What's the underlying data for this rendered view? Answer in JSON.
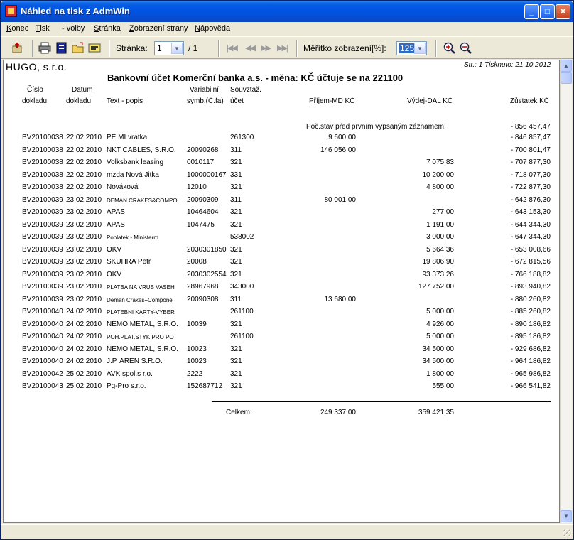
{
  "window": {
    "title": "Náhled na tisk z AdmWin"
  },
  "menu": [
    {
      "label": "Konec",
      "u": "K",
      "rest": "onec"
    },
    {
      "label": "Tisk",
      "u": "T",
      "rest": "isk"
    },
    {
      "label": "- volby",
      "u": "",
      "rest": "- volby"
    },
    {
      "label": "Stránka",
      "u": "S",
      "rest": "tránka"
    },
    {
      "label": "Zobrazení strany",
      "u": "Z",
      "rest": "obrazení strany"
    },
    {
      "label": "Nápověda",
      "u": "N",
      "rest": "ápověda"
    }
  ],
  "toolbar": {
    "page_label": "Stránka:",
    "page_value": "1",
    "page_total": "/ 1",
    "zoom_label": "Měřítko zobrazení[%]:",
    "zoom_value": "125"
  },
  "report": {
    "company": "HUGO, s.r.o.",
    "page_info": "Str.: 1   Tisknuto: 21.10.2012",
    "title": "Bankovní účet Komerční banka a.s. - měna: KČ  účtuje se na 221100",
    "headers": {
      "cislo1": "Číslo",
      "cislo2": "dokladu",
      "datum1": "Datum",
      "datum2": "dokladu",
      "text": "Text - popis",
      "var1": "Variabilní",
      "var2": "symb.(Č.fa)",
      "souv1": "Souvztaž.",
      "souv2": "účet",
      "prijem": "Příjem-MD KČ",
      "vydej": "Výdej-DAL KČ",
      "zustatek": "Zůstatek KČ"
    },
    "opening_label": "Poč.stav před prvním vypsaným záznamem:",
    "opening_value": "- 856 457,47",
    "rows": [
      {
        "doc": "BV20100038",
        "date": "22.02.2010",
        "text": "PE MI vratka",
        "vs": "",
        "acct": "261300",
        "in": "9 600,00",
        "out": "",
        "bal": "- 846 857,47",
        "sm": false
      },
      {
        "doc": "BV20100038",
        "date": "22.02.2010",
        "text": "NKT CABLES, S.R.O.",
        "vs": "20090268",
        "acct": "311",
        "in": "146 056,00",
        "out": "",
        "bal": "- 700 801,47",
        "sm": false
      },
      {
        "doc": "BV20100038",
        "date": "22.02.2010",
        "text": "Volksbank leasing",
        "vs": "0010117",
        "acct": "321",
        "in": "",
        "out": "7 075,83",
        "bal": "- 707 877,30",
        "sm": false
      },
      {
        "doc": "BV20100038",
        "date": "22.02.2010",
        "text": "mzda Nová Jitka",
        "vs": "1000000167",
        "acct": "331",
        "in": "",
        "out": "10 200,00",
        "bal": "- 718 077,30",
        "sm": false
      },
      {
        "doc": "BV20100038",
        "date": "22.02.2010",
        "text": "Nováková",
        "vs": "12010",
        "acct": "321",
        "in": "",
        "out": "4 800,00",
        "bal": "- 722 877,30",
        "sm": false
      },
      {
        "doc": "BV20100039",
        "date": "23.02.2010",
        "text": "DEMAN CRAKES&COMPO",
        "vs": "20090309",
        "acct": "311",
        "in": "80 001,00",
        "out": "",
        "bal": "- 642 876,30",
        "sm": true
      },
      {
        "doc": "BV20100039",
        "date": "23.02.2010",
        "text": "APAS",
        "vs": "10464604",
        "acct": "321",
        "in": "",
        "out": "277,00",
        "bal": "- 643 153,30",
        "sm": false
      },
      {
        "doc": "BV20100039",
        "date": "23.02.2010",
        "text": "APAS",
        "vs": "1047475",
        "acct": "321",
        "in": "",
        "out": "1 191,00",
        "bal": "- 644 344,30",
        "sm": false
      },
      {
        "doc": "BV20100039",
        "date": "23.02.2010",
        "text": "Poplatek - Ministerm",
        "vs": "",
        "acct": "538002",
        "in": "",
        "out": "3 000,00",
        "bal": "- 647 344,30",
        "sm": true
      },
      {
        "doc": "BV20100039",
        "date": "23.02.2010",
        "text": "OKV",
        "vs": "2030301850",
        "acct": "321",
        "in": "",
        "out": "5 664,36",
        "bal": "- 653 008,66",
        "sm": false
      },
      {
        "doc": "BV20100039",
        "date": "23.02.2010",
        "text": "SKUHRA Petr",
        "vs": "20008",
        "acct": "321",
        "in": "",
        "out": "19 806,90",
        "bal": "- 672 815,56",
        "sm": false
      },
      {
        "doc": "BV20100039",
        "date": "23.02.2010",
        "text": "OKV",
        "vs": "2030302554",
        "acct": "321",
        "in": "",
        "out": "93 373,26",
        "bal": "- 766 188,82",
        "sm": false
      },
      {
        "doc": "BV20100039",
        "date": "23.02.2010",
        "text": "PLATBA NA VRUB VASEH",
        "vs": "28967968",
        "acct": "343000",
        "in": "",
        "out": "127 752,00",
        "bal": "- 893 940,82",
        "sm": true
      },
      {
        "doc": "BV20100039",
        "date": "23.02.2010",
        "text": "Deman Crakes+Compone",
        "vs": "20090308",
        "acct": "311",
        "in": "13 680,00",
        "out": "",
        "bal": "- 880 260,82",
        "sm": true
      },
      {
        "doc": "BV20100040",
        "date": "24.02.2010",
        "text": "PLATEBNI KARTY-VYBER",
        "vs": "",
        "acct": "261100",
        "in": "",
        "out": "5 000,00",
        "bal": "- 885 260,82",
        "sm": true
      },
      {
        "doc": "BV20100040",
        "date": "24.02.2010",
        "text": "NEMO METAL, S.R.O.",
        "vs": "10039",
        "acct": "321",
        "in": "",
        "out": "4 926,00",
        "bal": "- 890 186,82",
        "sm": false
      },
      {
        "doc": "BV20100040",
        "date": "24.02.2010",
        "text": "POH.PLAT.STYK PRO PO",
        "vs": "",
        "acct": "261100",
        "in": "",
        "out": "5 000,00",
        "bal": "- 895 186,82",
        "sm": true
      },
      {
        "doc": "BV20100040",
        "date": "24.02.2010",
        "text": "NEMO METAL, S.R.O.",
        "vs": "10023",
        "acct": "321",
        "in": "",
        "out": "34 500,00",
        "bal": "- 929 686,82",
        "sm": false
      },
      {
        "doc": "BV20100040",
        "date": "24.02.2010",
        "text": "J.P. AREN S.R.O.",
        "vs": "10023",
        "acct": "321",
        "in": "",
        "out": "34 500,00",
        "bal": "- 964 186,82",
        "sm": false
      },
      {
        "doc": "BV20100042",
        "date": "25.02.2010",
        "text": "AVK spol.s r.o.",
        "vs": "2222",
        "acct": "321",
        "in": "",
        "out": "1 800,00",
        "bal": "- 965 986,82",
        "sm": false
      },
      {
        "doc": "BV20100043",
        "date": "25.02.2010",
        "text": "Pg-Pro s.r.o.",
        "vs": "152687712",
        "acct": "321",
        "in": "",
        "out": "555,00",
        "bal": "- 966 541,82",
        "sm": false
      }
    ],
    "total_label": "Celkem:",
    "total_in": "249 337,00",
    "total_out": "359 421,35"
  }
}
